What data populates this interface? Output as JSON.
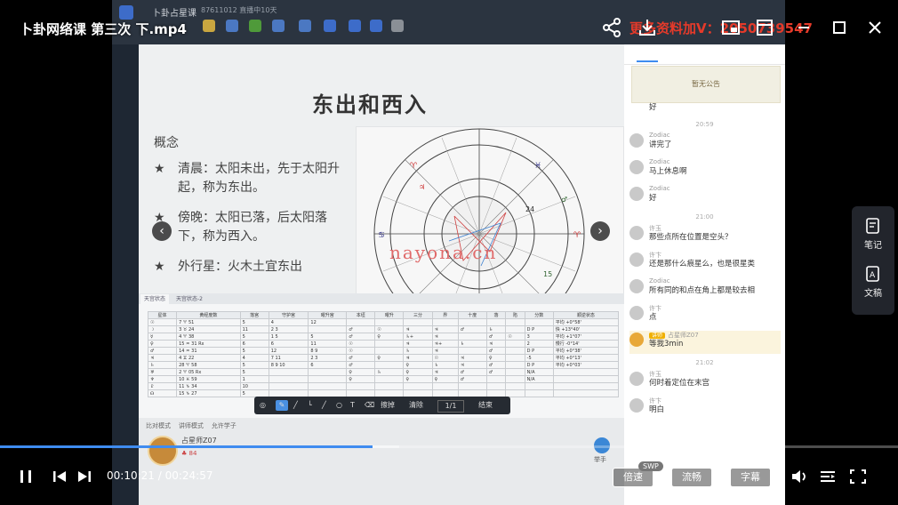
{
  "player": {
    "file_title": "卜卦网络课 第三次 下.mp4",
    "promo": "更多资料加V：2050739547",
    "current_time": "00:10:21",
    "duration": "00:24:57",
    "time_display": "00:10:21 / 00:24:57",
    "progress": 0.415,
    "buttons": {
      "speed": "倍速",
      "quality": "流畅",
      "subtitle": "字幕",
      "swp": "SWP"
    },
    "side_panel": {
      "notes": "笔记",
      "manuscript": "文稿"
    }
  },
  "recording": {
    "app_title": "卜卦占星课",
    "sub_status": "87611012  直播中10天",
    "slide": {
      "title": "东出和西入",
      "concept_label": "概念",
      "bullets": [
        "清晨：太阳未出，先于太阳升起，称为东出。",
        "傍晚：太阳已落，后太阳落下，称为西入。",
        "外行星：火木土宜东出"
      ],
      "watermark": "nayona.cn"
    },
    "table_tabs": [
      "天宫状态",
      "天宫状态-2"
    ],
    "table_headers": [
      "星体",
      "黄经度数",
      "落宫",
      "守护宫",
      "曜升宫",
      "本垣",
      "曜升",
      "三分",
      "界",
      "十度",
      "落",
      "陷",
      "分数",
      "顺逆状态"
    ],
    "table_rows": [
      [
        "☉",
        "7 ♈ 51",
        "5",
        "4",
        "12",
        "",
        "",
        "",
        "",
        "",
        "",
        "",
        "",
        "平均 +0°58'"
      ],
      [
        "☽",
        "3 ♉ 24",
        "11",
        "2 3",
        "",
        "♂",
        "☉",
        "♃",
        "♃",
        "♂",
        "♄",
        "",
        "D P",
        "快 +13°40'"
      ],
      [
        "☿",
        "4 ♈ 38",
        "5",
        "1 5",
        "5",
        "♂",
        "♀",
        "♄+",
        "♃",
        "",
        "♂",
        "☉",
        "3",
        "平均 +1°07'"
      ],
      [
        "♀",
        "15 ♒ 31 Rx",
        "6",
        "6",
        "11",
        "☉",
        "",
        "♃",
        "♃+",
        "♄",
        "♃",
        "",
        "2",
        "慢行 -0°14'"
      ],
      [
        "♂",
        "14 ♒ 31",
        "5",
        "12",
        "8 9",
        "☉",
        "",
        "♄",
        "♃",
        "",
        "♂",
        "",
        "D P",
        "平均 +0°38'"
      ],
      [
        "♃",
        "4 ♊ 22",
        "4",
        "7 11",
        "2 3",
        "♂",
        "♀",
        "♃",
        "☉",
        "♃",
        "♀",
        "",
        "-5",
        "平均 +0°13'"
      ],
      [
        "♄",
        "28 ♈ 58",
        "5",
        "8 9 10",
        "6",
        "♂",
        "",
        "♀",
        "♄",
        "♃",
        "♂",
        "",
        "D P",
        "平均 +0°03'"
      ],
      [
        "♅",
        "2 ♈ 05 Rx",
        "5",
        "",
        "",
        "♀",
        "♄",
        "♀",
        "♃",
        "♂",
        "♂",
        "",
        "N/A",
        ""
      ],
      [
        "♆",
        "10 ♓ 59",
        "1",
        "",
        "",
        "♀",
        "",
        "♀",
        "♀",
        "♂",
        "",
        "",
        "N/A",
        ""
      ],
      [
        "♇",
        "11 ♑ 34",
        "10",
        "",
        "",
        "",
        "",
        "",
        "",
        "",
        "",
        "",
        "",
        ""
      ],
      [
        "☊",
        "15 ♑ 27",
        "5",
        "",
        "",
        "",
        "",
        "",
        "",
        "",
        "",
        "",
        "",
        ""
      ]
    ],
    "draw_tools": {
      "erase": "擦掉",
      "clear": "清除",
      "page": "1/1",
      "end": "结束"
    },
    "bottom_tabs": [
      "比对模式",
      "讲师模式",
      "允许学子"
    ],
    "teacher": {
      "name": "占星师Z07",
      "tag": "♣ 84"
    },
    "fab_label": "举手"
  },
  "chat": {
    "notice": "暂无公告",
    "messages": [
      {
        "type": "text",
        "name": "",
        "text": "好"
      },
      {
        "type": "time",
        "text": "20:59"
      },
      {
        "type": "text",
        "name": "Zodiac",
        "text": "讲完了"
      },
      {
        "type": "text",
        "name": "Zodiac",
        "text": "马上休息啊"
      },
      {
        "type": "text",
        "name": "Zodiac",
        "text": "好"
      },
      {
        "type": "time",
        "text": "21:00"
      },
      {
        "type": "text",
        "name": "许玉",
        "text": "那些点所在位置是空头？"
      },
      {
        "type": "text",
        "name": "许卞",
        "text": "还是那什么痕星么，也是很星类"
      },
      {
        "type": "text",
        "name": "Zodiac",
        "text": "所有同的和点在角上都是较去相"
      },
      {
        "type": "text",
        "name": "许卞",
        "text": "点"
      },
      {
        "type": "highlight",
        "badge": "讲师",
        "name": "占星师Z07",
        "text": "等我3min"
      },
      {
        "type": "time",
        "text": "21:02"
      },
      {
        "type": "text",
        "name": "许玉",
        "text": "何时着定位在末宫"
      },
      {
        "type": "text",
        "name": "许卞",
        "text": "明白"
      }
    ]
  }
}
